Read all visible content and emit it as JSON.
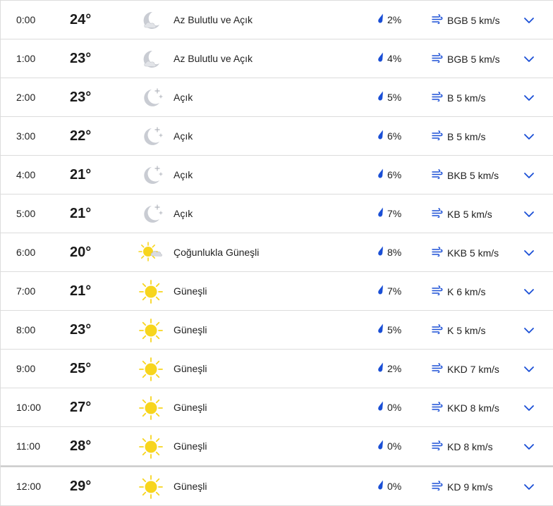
{
  "colors": {
    "accent": "#1a4fd6",
    "sun": "#f7d51d",
    "moon": "#c9ccd3",
    "cloud": "#b9bcc4",
    "divider": "#dcdcdc"
  },
  "icons": {
    "moon-cloud": "moon-cloud-icon",
    "moon-stars": "moon-stars-icon",
    "sun-cloud": "sun-cloud-icon",
    "sun": "sun-icon",
    "precip": "raindrop-icon",
    "wind": "wind-icon",
    "expand": "chevron-down-icon"
  },
  "hours": [
    {
      "time": "0:00",
      "temp": "24°",
      "icon": "moon-cloud",
      "condition": "Az Bulutlu ve Açık",
      "precip": "2%",
      "wind": "BGB 5 km/s"
    },
    {
      "time": "1:00",
      "temp": "23°",
      "icon": "moon-cloud",
      "condition": "Az Bulutlu ve Açık",
      "precip": "4%",
      "wind": "BGB 5 km/s"
    },
    {
      "time": "2:00",
      "temp": "23°",
      "icon": "moon-stars",
      "condition": "Açık",
      "precip": "5%",
      "wind": "B 5 km/s"
    },
    {
      "time": "3:00",
      "temp": "22°",
      "icon": "moon-stars",
      "condition": "Açık",
      "precip": "6%",
      "wind": "B 5 km/s"
    },
    {
      "time": "4:00",
      "temp": "21°",
      "icon": "moon-stars",
      "condition": "Açık",
      "precip": "6%",
      "wind": "BKB 5 km/s"
    },
    {
      "time": "5:00",
      "temp": "21°",
      "icon": "moon-stars",
      "condition": "Açık",
      "precip": "7%",
      "wind": "KB 5 km/s"
    },
    {
      "time": "6:00",
      "temp": "20°",
      "icon": "sun-cloud",
      "condition": "Çoğunlukla Güneşli",
      "precip": "8%",
      "wind": "KKB 5 km/s"
    },
    {
      "time": "7:00",
      "temp": "21°",
      "icon": "sun",
      "condition": "Güneşli",
      "precip": "7%",
      "wind": "K 6 km/s"
    },
    {
      "time": "8:00",
      "temp": "23°",
      "icon": "sun",
      "condition": "Güneşli",
      "precip": "5%",
      "wind": "K 5 km/s"
    },
    {
      "time": "9:00",
      "temp": "25°",
      "icon": "sun",
      "condition": "Güneşli",
      "precip": "2%",
      "wind": "KKD 7 km/s"
    },
    {
      "time": "10:00",
      "temp": "27°",
      "icon": "sun",
      "condition": "Güneşli",
      "precip": "0%",
      "wind": "KKD 8 km/s"
    },
    {
      "time": "11:00",
      "temp": "28°",
      "icon": "sun",
      "condition": "Güneşli",
      "precip": "0%",
      "wind": "KD 8 km/s"
    },
    {
      "time": "12:00",
      "temp": "29°",
      "icon": "sun",
      "condition": "Güneşli",
      "precip": "0%",
      "wind": "KD 9 km/s"
    }
  ]
}
